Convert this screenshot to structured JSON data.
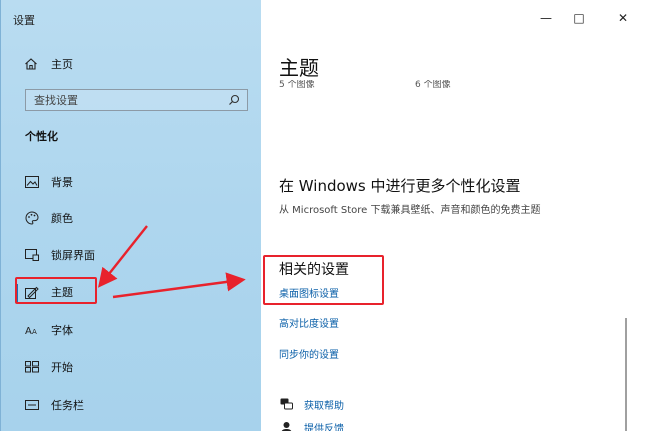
{
  "window": {
    "app_title": "设置",
    "controls": {
      "minimize": "—",
      "maximize": "□",
      "close": "✕"
    }
  },
  "sidebar": {
    "home_label": "主页",
    "search_placeholder": "查找设置",
    "section_title": "个性化",
    "items": [
      {
        "label": "背景",
        "icon": "picture-icon"
      },
      {
        "label": "颜色",
        "icon": "palette-icon"
      },
      {
        "label": "锁屏界面",
        "icon": "lock-screen-icon"
      },
      {
        "label": "主题",
        "icon": "theme-icon",
        "active": true
      },
      {
        "label": "字体",
        "icon": "font-icon"
      },
      {
        "label": "开始",
        "icon": "start-icon"
      },
      {
        "label": "任务栏",
        "icon": "taskbar-icon"
      }
    ]
  },
  "main": {
    "title": "主题",
    "thumb_captions": [
      "5 个图像",
      "6 个图像"
    ],
    "more_heading": "在 Windows 中进行更多个性化设置",
    "more_subtitle": "从 Microsoft Store 下载兼具壁纸、声音和颜色的免费主题",
    "related_heading": "相关的设置",
    "related_links": [
      "桌面图标设置",
      "高对比度设置",
      "同步你的设置"
    ],
    "help_links": [
      {
        "label": "获取帮助",
        "icon": "help-chat-icon"
      },
      {
        "label": "提供反馈",
        "icon": "feedback-icon"
      }
    ]
  },
  "colors": {
    "sidebar_bg": "#aed6ee",
    "accent": "#1a6fb5",
    "link": "#0a5fa8",
    "annotation_red": "#e8222c"
  }
}
